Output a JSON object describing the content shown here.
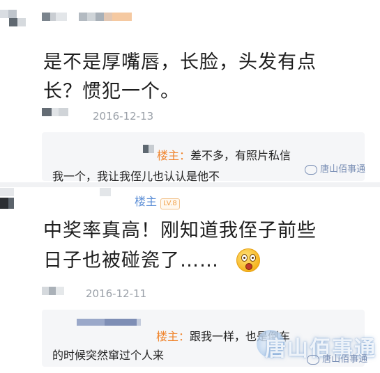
{
  "comment1": {
    "text_line1": "是不是厚嘴唇，长脸，头发有点",
    "text_line2": "长？惯犯一个。",
    "date": "2016-12-13",
    "reply": {
      "author": "楼主：",
      "text_line1": "差不多，有照片私信",
      "text_line2": "我一个，我让我侄儿也认认是他不"
    }
  },
  "comment2": {
    "author_name": "楼主",
    "badge": "LV.8",
    "text_line1": "中奖率真高！刚知道我侄子前些",
    "text_line2": "日子也被碰瓷了……",
    "date": "2016-12-11",
    "reply": {
      "author": "楼主：",
      "text_line1": "跟我一样，也是倒车",
      "text_line2": "的时候突然窜过个人来"
    }
  },
  "watermark": {
    "small": "唐山佰事通",
    "large": "唐山佰事通"
  },
  "colors": {
    "reply_author": "#f0842c",
    "louzhu": "#5b8ed6",
    "meta_gray": "#9aa0a8",
    "reply_bg": "#f5f6f8"
  },
  "icons": [
    "pixelated-avatar",
    "shocked-face-emoji",
    "watermark-logo-icon"
  ]
}
